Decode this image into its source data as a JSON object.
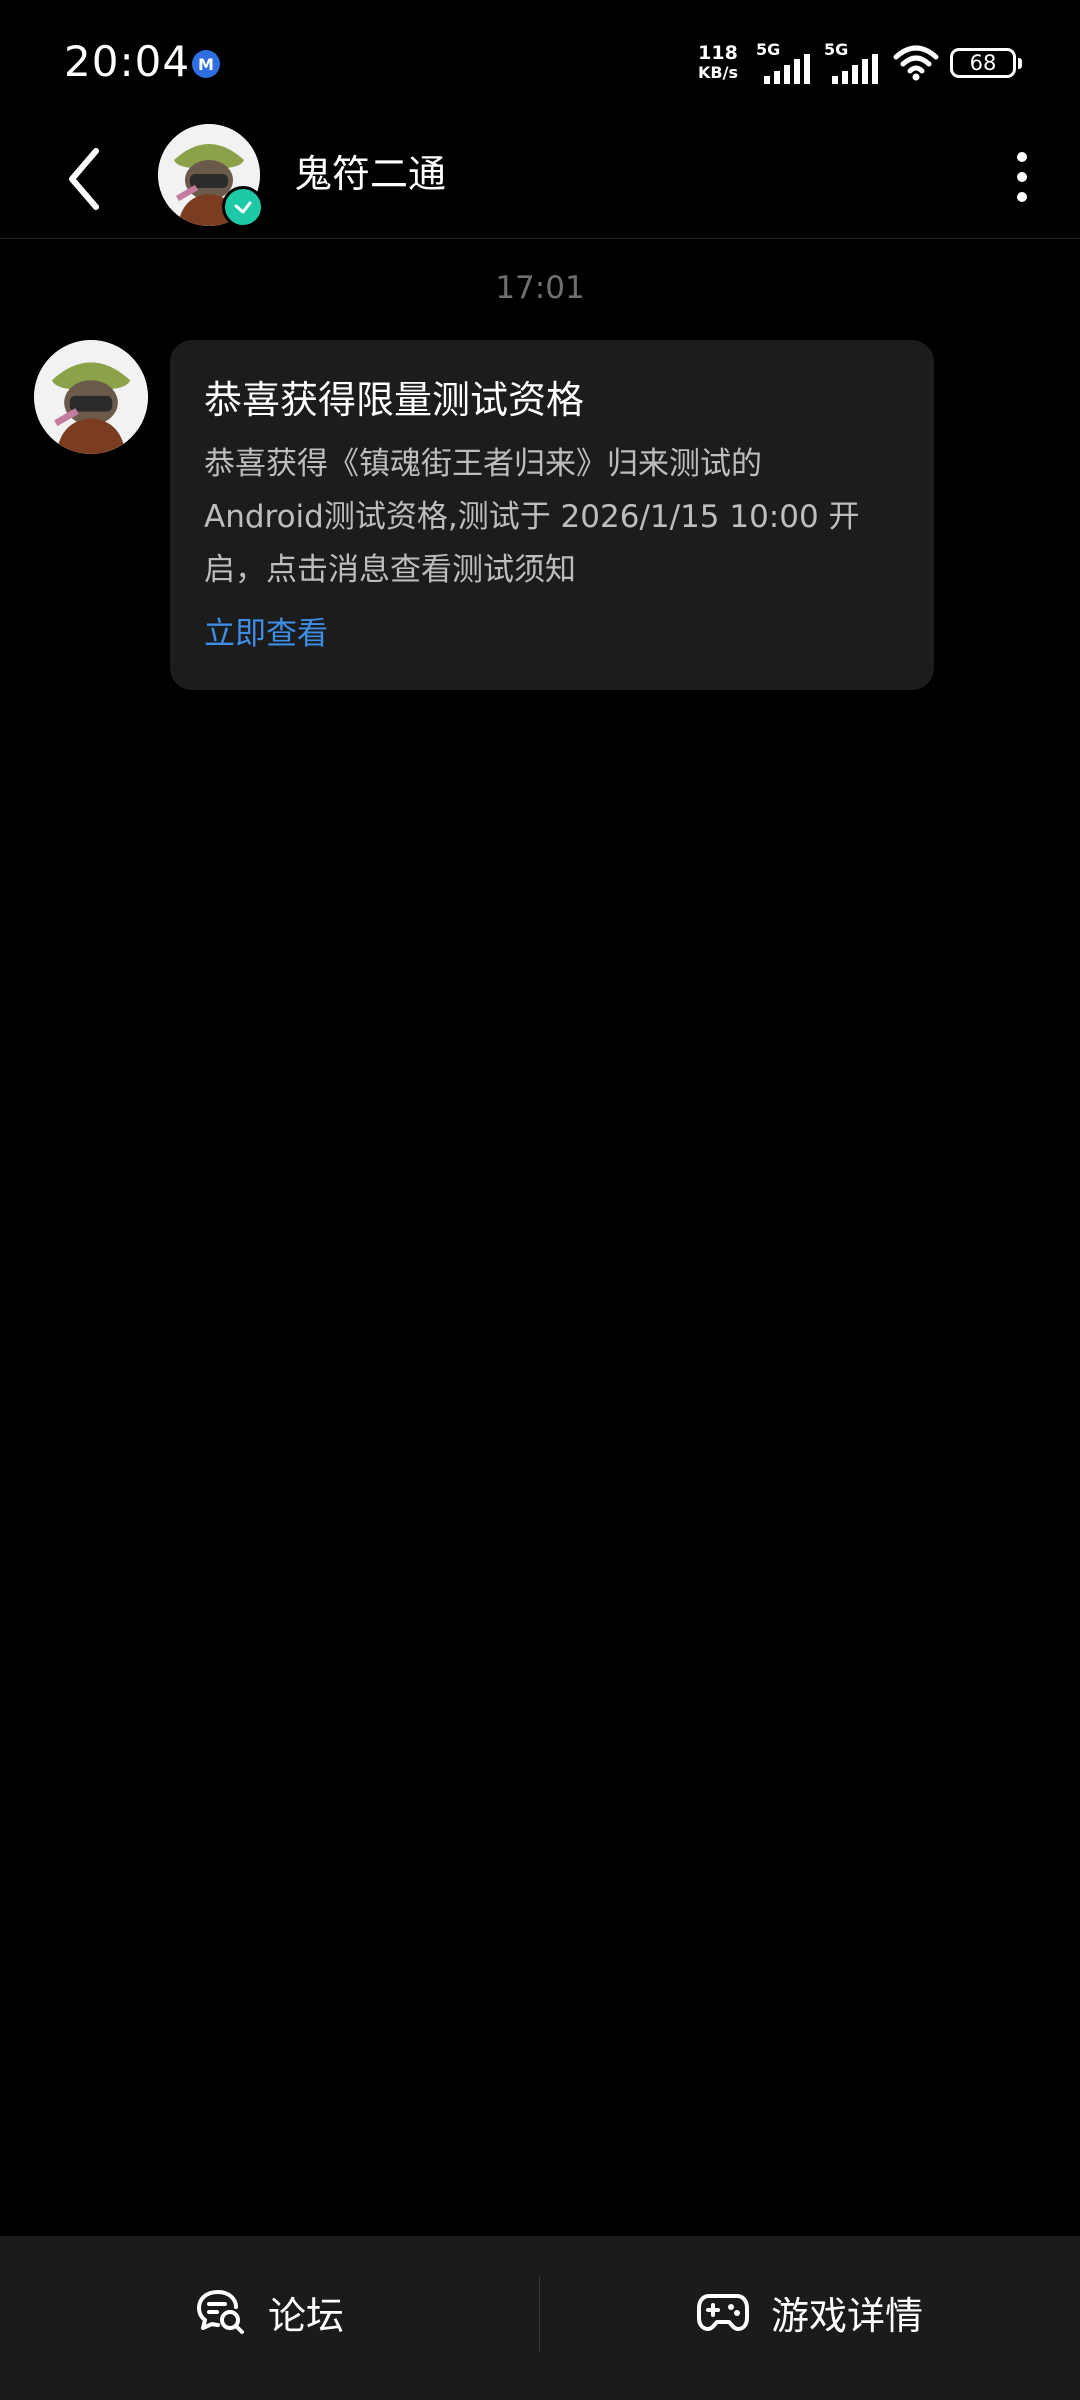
{
  "status_bar": {
    "time": "20:04",
    "app_icon": "M",
    "net_speed_value": "118",
    "net_speed_unit": "KB/s",
    "sim1_network": "5G",
    "sim2_network": "5G",
    "battery_level": "68"
  },
  "header": {
    "title": "鬼符二通",
    "back_icon": "chevron-left-icon",
    "more_icon": "more-vertical-icon",
    "verified_icon": "verified-check-icon"
  },
  "chat": {
    "timestamp": "17:01",
    "message": {
      "title": "恭喜获得限量测试资格",
      "body_line1": "恭喜获得《镇魂街王者归来》归来测试的",
      "body_line2": "Android测试资格,测试于 2026/1/15 10:00 开",
      "body_line3": "启，点击消息查看测试须知",
      "link_label": "立即查看"
    }
  },
  "bottom_bar": {
    "forum_label": "论坛",
    "game_details_label": "游戏详情"
  },
  "colors": {
    "background": "#000000",
    "bubble": "#1c1c1c",
    "link": "#3d8ee6",
    "verified": "#1ec9a8",
    "bottom_bar": "#1b1b1b"
  }
}
